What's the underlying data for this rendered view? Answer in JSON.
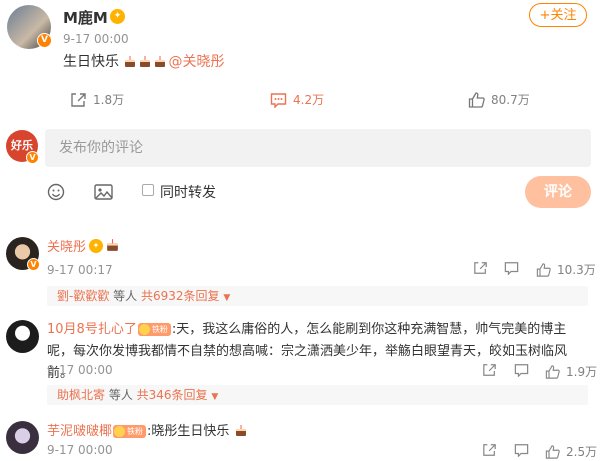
{
  "post": {
    "author": "M鹿M",
    "time": "9-17 00:00",
    "text": "生日快乐",
    "mention": "@关晓彤",
    "follow_label": "+关注",
    "reposts": "1.8万",
    "comments": "4.2万",
    "likes": "80.7万"
  },
  "composer": {
    "placeholder": "发布你的评论",
    "repost_label": "同时转发",
    "submit_label": "评论"
  },
  "comments": [
    {
      "author": "关晓彤",
      "time": "9-17 00:17",
      "likes": "10.3万",
      "reply_user": "劉-歡歡歡",
      "reply_middle": " 等人 ",
      "reply_count": "共6932条回复"
    },
    {
      "author": "10月8号扎心了",
      "fan_badge": "铁粉",
      "text": ":天，我这么庸俗的人，怎么能刷到你这种充满智慧，帅气完美的博主呢，每次你发博我都情不自禁的想高喊：宗之潇洒美少年，举觞白眼望青天，皎如玉树临风前。",
      "time": "9-17 00:00",
      "likes": "1.9万",
      "reply_user": "助枫北寄",
      "reply_middle": " 等人 ",
      "reply_count": "共346条回复"
    },
    {
      "author": "芋泥啵啵椰",
      "fan_badge": "铁粉",
      "text": ":晓彤生日快乐",
      "time": "9-17 00:00",
      "likes": "2.5万"
    }
  ],
  "colors": {
    "accent": "#ff8200",
    "link": "#eb7350",
    "muted": "#939393"
  }
}
